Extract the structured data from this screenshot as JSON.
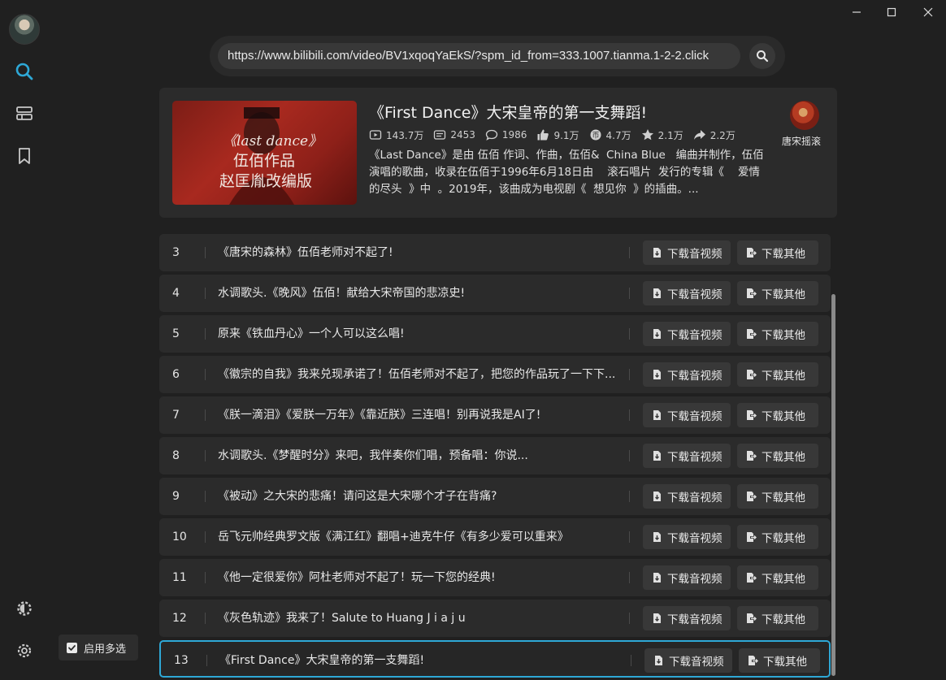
{
  "window": {
    "controls": [
      "minimize-icon",
      "maximize-icon",
      "close-icon"
    ]
  },
  "sidebar": {
    "items": [
      {
        "name": "search",
        "icon": "search-icon",
        "active": true
      },
      {
        "name": "list",
        "icon": "list-icon"
      },
      {
        "name": "bookmark",
        "icon": "bookmark-icon"
      }
    ],
    "bottom": [
      {
        "name": "theme",
        "icon": "theme-gear-icon"
      },
      {
        "name": "settings",
        "icon": "gear-icon"
      }
    ],
    "accent": "#2ea8d6"
  },
  "search": {
    "url": "https://www.bilibili.com/video/BV1xqoqYaEkS/?spm_id_from=333.1007.tianma.1-2-2.click"
  },
  "video": {
    "title": "《First Dance》大宋皇帝的第一支舞蹈!",
    "stats": {
      "views": "143.7万",
      "danmaku": "2453",
      "comments": "1986",
      "likes": "9.1万",
      "coins": "4.7万",
      "favorites": "2.1万",
      "shares": "2.2万"
    },
    "description_lines": [
      "《Last Dance》是由 伍佰 作词、作曲，伍佰&  China Blue   编曲并制作，伍佰",
      "演唱的歌曲，收录在伍佰于1996年6月18日由    滚石唱片  发行的专辑《    爱情",
      "的尽头  》中  。2019年，该曲成为电视剧《  想见你  》的插曲。..."
    ],
    "uploader": "唐宋摇滚",
    "thumbnail_text": [
      "《last dance》",
      "伍佰作品",
      "赵匡胤改编版"
    ]
  },
  "list": {
    "download_av_label": "下载音视频",
    "download_other_label": "下载其他",
    "selected_color": "#2ea8d6",
    "rows": [
      {
        "num": "3",
        "title": "《唐宋的森林》伍佰老师对不起了!"
      },
      {
        "num": "4",
        "title": "水调歌头.《晚风》伍佰！献给大宋帝国的悲凉史!"
      },
      {
        "num": "5",
        "title": "原来《铁血丹心》一个人可以这么唱!"
      },
      {
        "num": "6",
        "title": "《徽宗的自我》我来兑现承诺了！伍佰老师对不起了，把您的作品玩了一下下..."
      },
      {
        "num": "7",
        "title": "《朕一滴泪》《爱朕一万年》《靠近朕》三连唱！别再说我是AI了!"
      },
      {
        "num": "8",
        "title": "水调歌头.《梦醒时分》来吧，我伴奏你们唱，预备唱：你说..."
      },
      {
        "num": "9",
        "title": "《被动》之大宋的悲痛！请问这是大宋哪个才子在背痛?"
      },
      {
        "num": "10",
        "title": "岳飞元帅经典罗文版《满江红》翻唱+迪克牛仔《有多少爱可以重来》"
      },
      {
        "num": "11",
        "title": "《他一定很爱你》阿杜老师对不起了！玩一下您的经典!"
      },
      {
        "num": "12",
        "title": "《灰色轨迹》我来了！Salute to Huang J i a j u"
      },
      {
        "num": "13",
        "title": "《First Dance》大宋皇帝的第一支舞蹈!",
        "selected": true
      }
    ]
  },
  "multiselect": {
    "label": "启用多选",
    "checked": true
  }
}
